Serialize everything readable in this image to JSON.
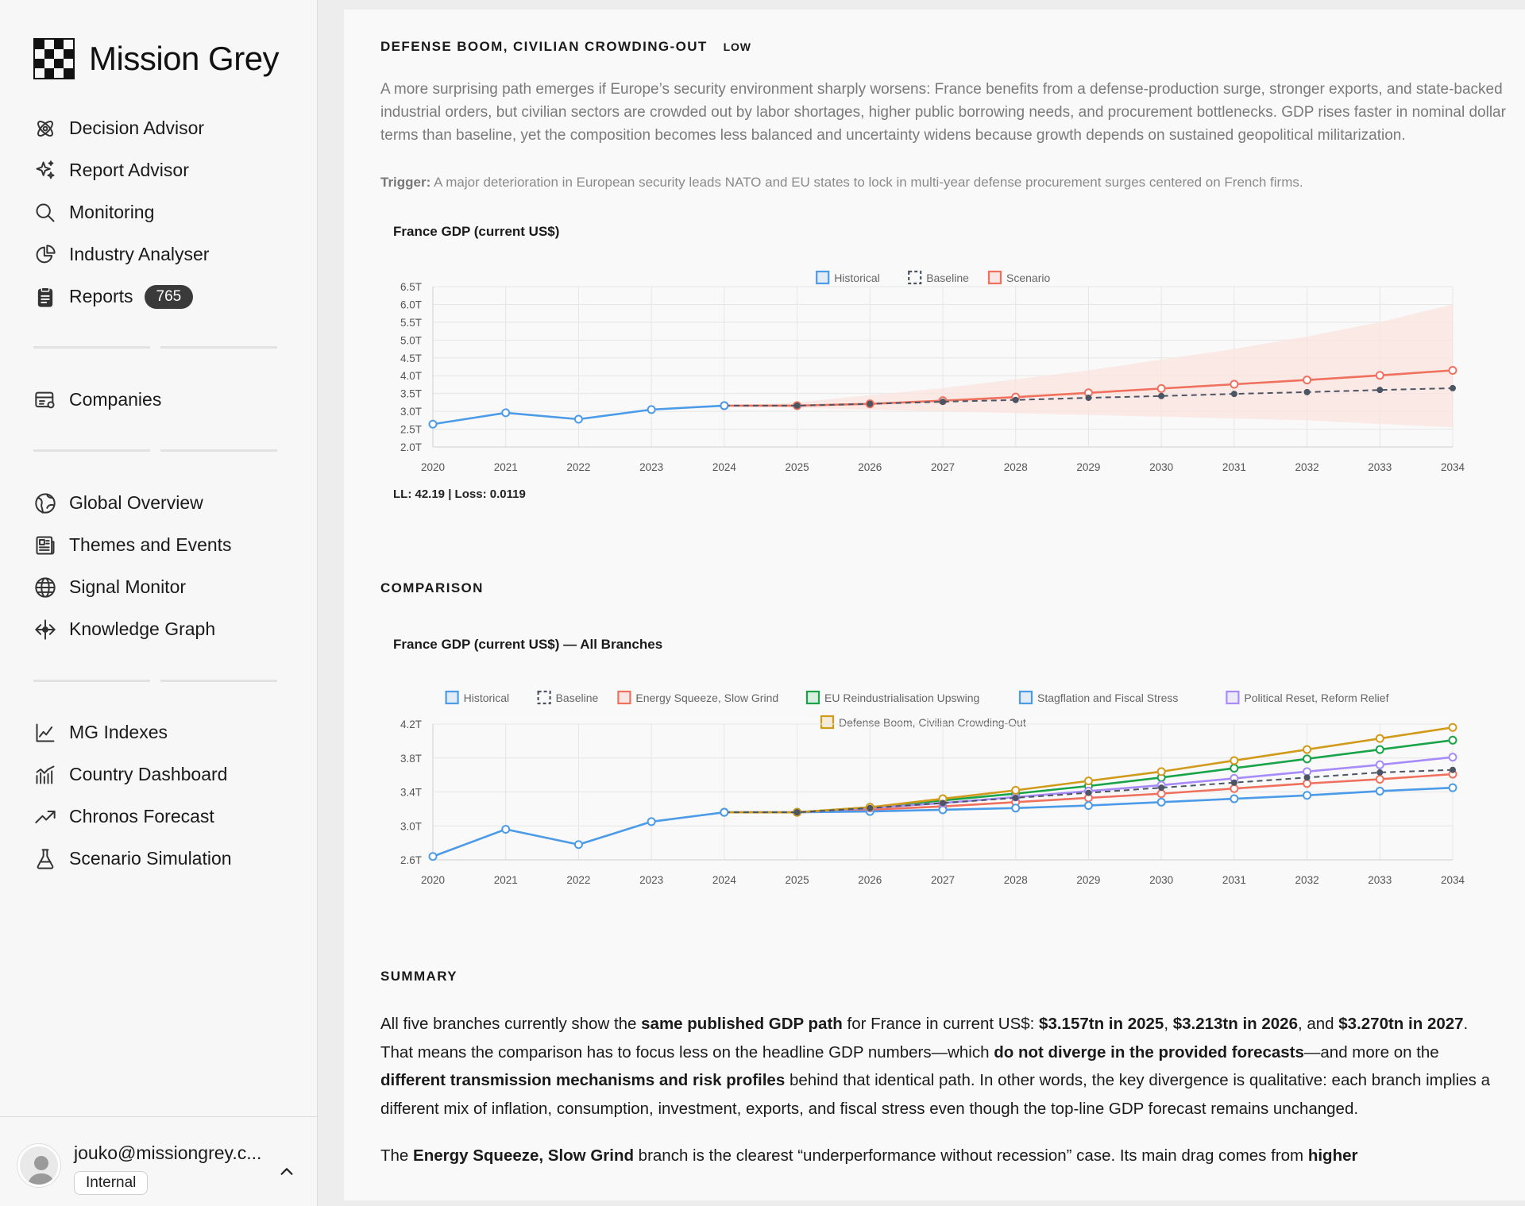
{
  "app": {
    "name": "Mission Grey"
  },
  "nav": {
    "group1": [
      {
        "label": "Decision Advisor",
        "icon": "atom-icon"
      },
      {
        "label": "Report Advisor",
        "icon": "sparkles-icon"
      },
      {
        "label": "Monitoring",
        "icon": "search-icon"
      },
      {
        "label": "Industry Analyser",
        "icon": "pie-chart-icon"
      },
      {
        "label": "Reports",
        "icon": "clipboard-icon",
        "badge": "765"
      }
    ],
    "group2": [
      {
        "label": "Companies",
        "icon": "companies-icon"
      }
    ],
    "group3": [
      {
        "label": "Global Overview",
        "icon": "globe-slash-icon"
      },
      {
        "label": "Themes and Events",
        "icon": "newspaper-icon"
      },
      {
        "label": "Signal Monitor",
        "icon": "globe-icon"
      },
      {
        "label": "Knowledge Graph",
        "icon": "graph-icon"
      }
    ],
    "group4": [
      {
        "label": "MG Indexes",
        "icon": "line-chart-icon"
      },
      {
        "label": "Country Dashboard",
        "icon": "bar-line-icon"
      },
      {
        "label": "Chronos Forecast",
        "icon": "trend-up-icon"
      },
      {
        "label": "Scenario Simulation",
        "icon": "flask-icon"
      }
    ]
  },
  "user": {
    "email": "jouko@missiongrey.c...",
    "role": "Internal"
  },
  "scenario": {
    "title": "DEFENSE BOOM, CIVILIAN CROWDING-OUT",
    "likelihood": "LOW",
    "description": "A more surprising path emerges if Europe’s security environment sharply worsens: France benefits from a defense-production surge, stronger exports, and state-backed industrial orders, but civilian sectors are crowded out by labor shortages, higher public borrowing needs, and procurement bottlenecks. GDP rises faster in nominal dollar terms than baseline, yet the composition becomes less balanced and uncertainty widens because growth depends on sustained geopolitical militarization.",
    "trigger_label": "Trigger:",
    "trigger_text": "A major deterioration in European security leads NATO and EU states to lock in multi-year defense procurement surges centered on French firms.",
    "fit_stats": "LL: 42.19 | Loss: 0.0119"
  },
  "comparison": {
    "title": "COMPARISON"
  },
  "summary": {
    "title": "SUMMARY"
  },
  "colors": {
    "historical": "#4c9be8",
    "baseline": "#4b5563",
    "scenario": "#f0705e",
    "energy": "#f0705e",
    "eu": "#1aa44a",
    "stagflation": "#4c9be8",
    "political": "#a78bfa",
    "defense": "#d29a1a",
    "band": "#fbe3df"
  },
  "chart_data": [
    {
      "type": "line",
      "title": "France GDP (current US$)",
      "legend": [
        "Historical",
        "Baseline",
        "Scenario"
      ],
      "legend_position": "top-center",
      "grid": true,
      "ylim": [
        2.0,
        6.5
      ],
      "yticks": [
        "6.5T",
        "6.0T",
        "5.5T",
        "5.0T",
        "4.5T",
        "4.0T",
        "3.5T",
        "3.0T",
        "2.5T",
        "2.0T"
      ],
      "x": [
        2020,
        2021,
        2022,
        2023,
        2024,
        2025,
        2026,
        2027,
        2028,
        2029,
        2030,
        2031,
        2032,
        2033,
        2034
      ],
      "series": [
        {
          "name": "Historical",
          "x": [
            2020,
            2021,
            2022,
            2023,
            2024
          ],
          "values": [
            2.64,
            2.96,
            2.78,
            3.05,
            3.16
          ]
        },
        {
          "name": "Baseline",
          "x": [
            2024,
            2025,
            2026,
            2027,
            2028,
            2029,
            2030,
            2031,
            2032,
            2033,
            2034
          ],
          "values": [
            3.16,
            3.16,
            3.21,
            3.27,
            3.32,
            3.38,
            3.43,
            3.49,
            3.54,
            3.6,
            3.65
          ]
        },
        {
          "name": "Scenario",
          "x": [
            2024,
            2025,
            2026,
            2027,
            2028,
            2029,
            2030,
            2031,
            2032,
            2033,
            2034
          ],
          "values": [
            3.16,
            3.16,
            3.21,
            3.3,
            3.4,
            3.52,
            3.64,
            3.76,
            3.88,
            4.01,
            4.15
          ]
        }
      ],
      "band": {
        "x": [
          2024,
          2025,
          2026,
          2027,
          2028,
          2029,
          2030,
          2031,
          2032,
          2033,
          2034
        ],
        "upper": [
          3.16,
          3.25,
          3.45,
          3.65,
          3.9,
          4.15,
          4.45,
          4.75,
          5.1,
          5.5,
          6.0
        ],
        "lower": [
          3.16,
          3.1,
          3.05,
          3.0,
          2.95,
          2.9,
          2.85,
          2.8,
          2.75,
          2.65,
          2.55
        ]
      }
    },
    {
      "type": "line",
      "title": "France GDP (current US$) — All Branches",
      "legend": [
        "Historical",
        "Baseline",
        "Energy Squeeze, Slow Grind",
        "EU Reindustrialisation Upswing",
        "Stagflation and Fiscal Stress",
        "Political Reset, Reform Relief",
        "Defense Boom, Civilian Crowding-Out"
      ],
      "legend_position": "top-center",
      "grid": true,
      "ylim": [
        2.6,
        4.2
      ],
      "yticks": [
        "4.2T",
        "3.8T",
        "3.4T",
        "3.0T",
        "2.6T"
      ],
      "x": [
        2020,
        2021,
        2022,
        2023,
        2024,
        2025,
        2026,
        2027,
        2028,
        2029,
        2030,
        2031,
        2032,
        2033,
        2034
      ],
      "series": [
        {
          "name": "Historical",
          "x": [
            2020,
            2021,
            2022,
            2023,
            2024
          ],
          "values": [
            2.64,
            2.96,
            2.78,
            3.05,
            3.16
          ]
        },
        {
          "name": "Baseline",
          "x": [
            2024,
            2025,
            2026,
            2027,
            2028,
            2029,
            2030,
            2031,
            2032,
            2033,
            2034
          ],
          "values": [
            3.16,
            3.16,
            3.21,
            3.27,
            3.33,
            3.39,
            3.45,
            3.51,
            3.57,
            3.63,
            3.66
          ]
        },
        {
          "name": "Energy Squeeze, Slow Grind",
          "x": [
            2024,
            2025,
            2026,
            2027,
            2028,
            2029,
            2030,
            2031,
            2032,
            2033,
            2034
          ],
          "values": [
            3.16,
            3.16,
            3.19,
            3.23,
            3.28,
            3.33,
            3.38,
            3.44,
            3.5,
            3.55,
            3.61
          ]
        },
        {
          "name": "EU Reindustrialisation Upswing",
          "x": [
            2024,
            2025,
            2026,
            2027,
            2028,
            2029,
            2030,
            2031,
            2032,
            2033,
            2034
          ],
          "values": [
            3.16,
            3.16,
            3.22,
            3.3,
            3.38,
            3.47,
            3.57,
            3.68,
            3.79,
            3.9,
            4.01
          ]
        },
        {
          "name": "Stagflation and Fiscal Stress",
          "x": [
            2024,
            2025,
            2026,
            2027,
            2028,
            2029,
            2030,
            2031,
            2032,
            2033,
            2034
          ],
          "values": [
            3.16,
            3.16,
            3.17,
            3.19,
            3.21,
            3.24,
            3.28,
            3.32,
            3.36,
            3.41,
            3.45
          ]
        },
        {
          "name": "Political Reset, Reform Relief",
          "x": [
            2024,
            2025,
            2026,
            2027,
            2028,
            2029,
            2030,
            2031,
            2032,
            2033,
            2034
          ],
          "values": [
            3.16,
            3.16,
            3.21,
            3.27,
            3.34,
            3.41,
            3.48,
            3.56,
            3.64,
            3.72,
            3.81
          ]
        },
        {
          "name": "Defense Boom, Civilian Crowding-Out",
          "x": [
            2024,
            2025,
            2026,
            2027,
            2028,
            2029,
            2030,
            2031,
            2032,
            2033,
            2034
          ],
          "values": [
            3.16,
            3.16,
            3.22,
            3.32,
            3.42,
            3.53,
            3.64,
            3.77,
            3.9,
            4.03,
            4.16
          ]
        }
      ]
    }
  ],
  "summary_text": {
    "p1": [
      {
        "t": "All five branches currently show the ",
        "b": false
      },
      {
        "t": "same published GDP path",
        "b": true
      },
      {
        "t": " for France in current US$: ",
        "b": false
      },
      {
        "t": "$3.157tn in 2025",
        "b": true
      },
      {
        "t": ", ",
        "b": false
      },
      {
        "t": "$3.213tn in 2026",
        "b": true
      },
      {
        "t": ", and ",
        "b": false
      },
      {
        "t": "$3.270tn in 2027",
        "b": true
      },
      {
        "t": ". That means the comparison has to focus less on the headline GDP numbers—which ",
        "b": false
      },
      {
        "t": "do not diverge in the provided forecasts",
        "b": true
      },
      {
        "t": "—and more on the ",
        "b": false
      },
      {
        "t": "different transmission mechanisms and risk profiles",
        "b": true
      },
      {
        "t": " behind that identical path. In other words, the key divergence is qualitative: each branch implies a different mix of inflation, consumption, investment, exports, and fiscal stress even though the top-line GDP forecast remains unchanged.",
        "b": false
      }
    ],
    "p2": [
      {
        "t": "The ",
        "b": false
      },
      {
        "t": "Energy Squeeze, Slow Grind",
        "b": true
      },
      {
        "t": " branch is the clearest “underperformance without recession” case. Its main drag comes from ",
        "b": false
      },
      {
        "t": "higher",
        "b": true
      }
    ]
  }
}
